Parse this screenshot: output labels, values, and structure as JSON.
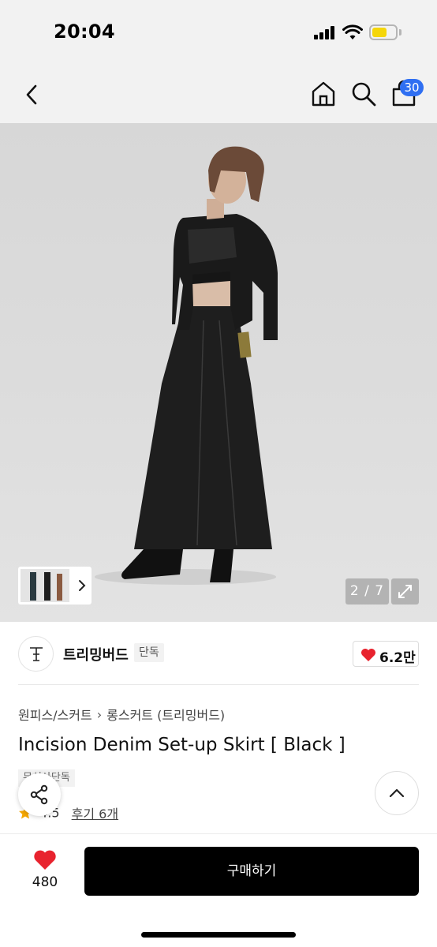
{
  "status_bar": {
    "time": "20:04"
  },
  "nav": {
    "cart_count": "30"
  },
  "gallery": {
    "counter": "2 / 7"
  },
  "brand": {
    "name": "트리밍버드",
    "tag": "단독",
    "likes": "6.2만"
  },
  "product": {
    "breadcrumb": [
      "원피스/스커트",
      "롱스커트 (트리밍버드)"
    ],
    "breadcrumb_separator": "›",
    "title": "Incision Denim Set-up Skirt [ Black ]",
    "tags": "무신사단독",
    "rating": "4.5",
    "reviews": "후기 6개"
  },
  "bottom_bar": {
    "wish_count": "480",
    "buy_label": "구매하기"
  },
  "colors": {
    "accent_blue": "#2f6ff2",
    "like_red": "#e8232e",
    "star_orange": "#f5a700",
    "buy_black": "#000000",
    "battery_yellow": "#f5d60a"
  },
  "icons": [
    "back-icon",
    "home-icon",
    "search-icon",
    "cart-icon",
    "expand-icon",
    "heart-icon",
    "star-icon",
    "share-icon",
    "chevron-up-icon",
    "chevron-right-icon"
  ]
}
